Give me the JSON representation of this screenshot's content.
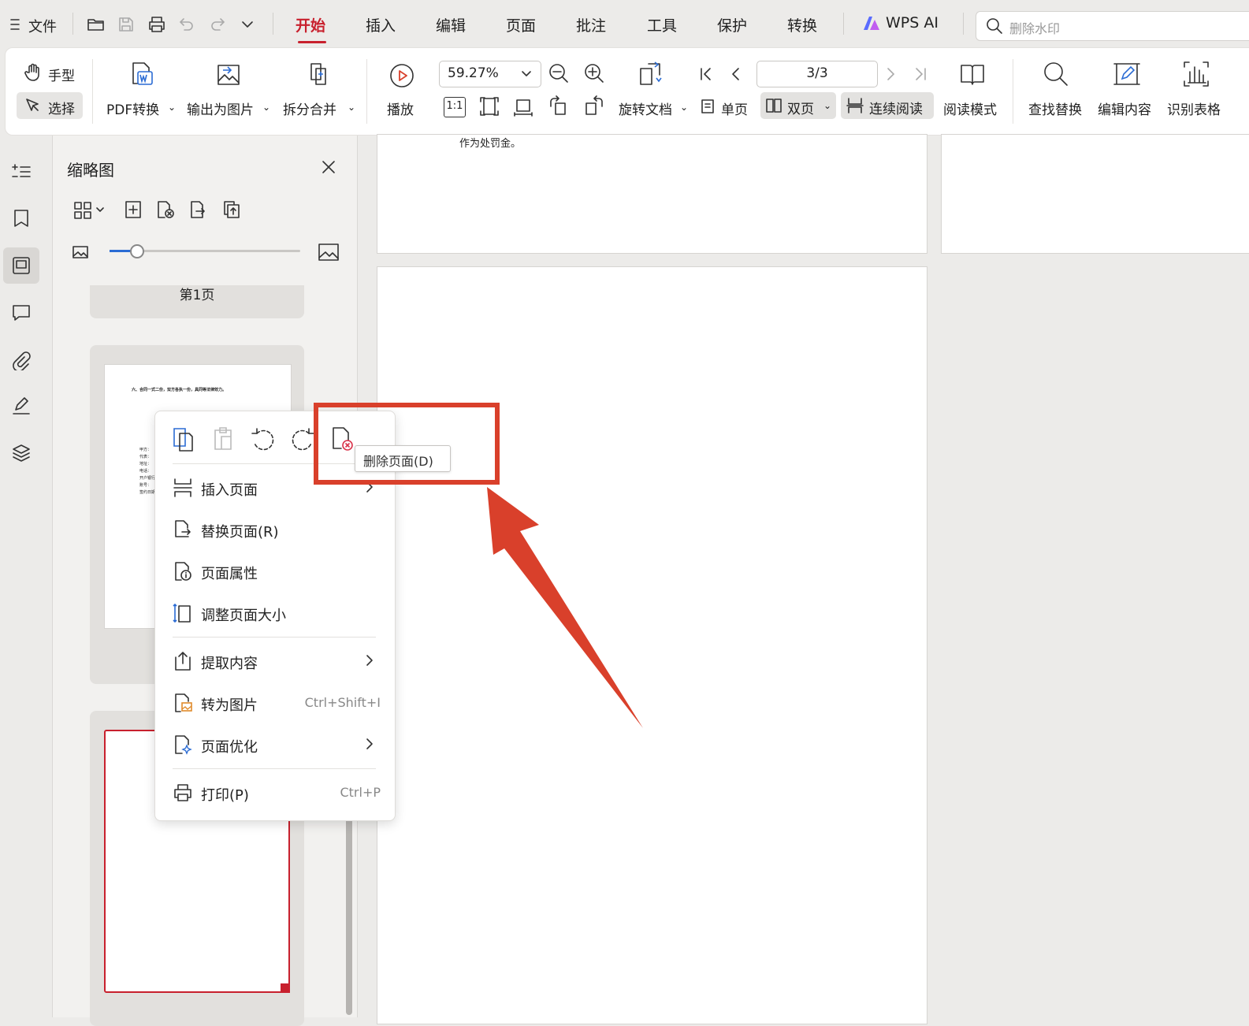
{
  "menubar": {
    "file": "文件",
    "tabs": [
      {
        "label": "开始",
        "active": true
      },
      {
        "label": "插入"
      },
      {
        "label": "编辑"
      },
      {
        "label": "页面"
      },
      {
        "label": "批注"
      },
      {
        "label": "工具"
      },
      {
        "label": "保护"
      },
      {
        "label": "转换"
      }
    ],
    "wps_ai": "WPS AI",
    "search_placeholder": "删除水印"
  },
  "ribbon": {
    "hand": "手型",
    "select": "选择",
    "pdf_convert": "PDF转换",
    "export_image": "输出为图片",
    "split_merge": "拆分合并",
    "play": "播放",
    "zoom": "59.27%",
    "rotate_doc": "旋转文档",
    "page_indicator": "3/3",
    "single_page": "单页",
    "double_page": "双页",
    "continuous": "连续阅读",
    "reading_mode": "阅读模式",
    "find_replace": "查找替换",
    "edit_content": "编辑内容",
    "recognize_table": "识别表格",
    "actual_size": "1:1"
  },
  "panel": {
    "title": "缩略图",
    "page1_label": "第1页",
    "thumb2_line": "六、合同一式二份，双方各执一份，具同等法律效力。",
    "thumb2_fields": [
      "甲方：",
      "代表：",
      "地址：",
      "电话：",
      "开户银行：",
      "账号：",
      "签约日期"
    ]
  },
  "doc": {
    "top_text": "作为处罚金。"
  },
  "context_menu": {
    "items": [
      {
        "label": "插入页面",
        "shortcut": "",
        "submenu": true
      },
      {
        "label": "替换页面(R)",
        "shortcut": "",
        "submenu": false
      },
      {
        "label": "页面属性",
        "shortcut": "",
        "submenu": false
      },
      {
        "label": "调整页面大小",
        "shortcut": "",
        "submenu": false
      },
      {
        "label": "提取内容",
        "shortcut": "",
        "submenu": true
      },
      {
        "label": "转为图片",
        "shortcut": "Ctrl+Shift+I",
        "submenu": false
      },
      {
        "label": "页面优化",
        "shortcut": "",
        "submenu": true
      },
      {
        "label": "打印(P)",
        "shortcut": "Ctrl+P",
        "submenu": false
      }
    ],
    "tooltip": "删除页面(D)"
  },
  "colors": {
    "accent": "#c8202d",
    "highlight": "#d9402b",
    "delete_icon": "#d9334a"
  },
  "icons": {
    "toolbar": [
      "menu-icon",
      "open-folder-icon",
      "save-icon",
      "print-icon",
      "undo-icon",
      "redo-icon",
      "chevron-down-icon"
    ],
    "rail": [
      "outline-icon",
      "bookmark-icon",
      "thumbnail-icon",
      "comment-icon",
      "attachment-icon",
      "signature-icon",
      "layers-icon"
    ],
    "ctx_top": [
      "copy-page-icon",
      "paste-page-icon",
      "rotate-left-icon",
      "rotate-right-icon",
      "delete-page-icon"
    ]
  }
}
